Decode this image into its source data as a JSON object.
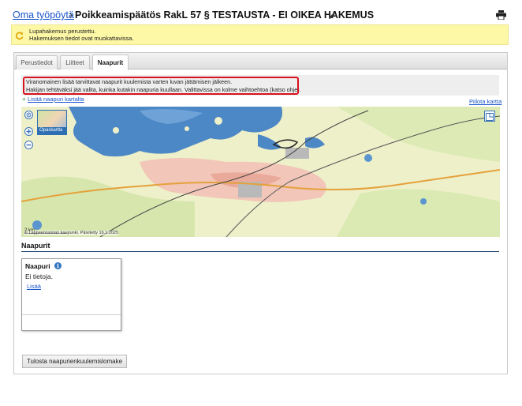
{
  "header": {
    "breadcrumb_link": "Oma työpöytä",
    "separator": "›",
    "title": "Poikkeamispäätös RakL 57 § TESTAUSTA - EI OIKEA HAKEMUS"
  },
  "notice": {
    "line1": "Lupahakemus perustettu.",
    "line2": "Hakemuksen tiedot ovat muokattavissa."
  },
  "tabs": [
    {
      "label": "Perustiedot"
    },
    {
      "label": "Liitteet"
    },
    {
      "label": "Naapurit",
      "active": true
    }
  ],
  "info": {
    "line1": "Viranomainen lisää tarvittavat naapurit kuulemista varten luvan jättämisen jälkeen.",
    "line2": "Hakijan tehtäväksi jää valita, kuinka kutakin naapuria kuullaan. Valittavissa on kolme vaihtoehtoa (katso ohje)."
  },
  "map_links": {
    "add_neighbor": "Lisää naapuri kartalta",
    "hide_map": "Piilota kartta"
  },
  "map": {
    "layer_label": "Opaskartta",
    "scale": "2 km",
    "attribution": "© Lappeenrannan kaupunki. Päivitetty 16.1.2025"
  },
  "section": {
    "title": "Naapurit"
  },
  "card": {
    "title": "Naapuri",
    "empty_text": "Ei tietoja.",
    "add_link": "Lisää"
  },
  "print_button": "Tulosta naapurienkuulemislomake",
  "colors": {
    "link": "#1a55c9",
    "notice_bg": "#fdf8a6",
    "highlight": "#d9121f",
    "section_rule": "#1f3f6e"
  }
}
